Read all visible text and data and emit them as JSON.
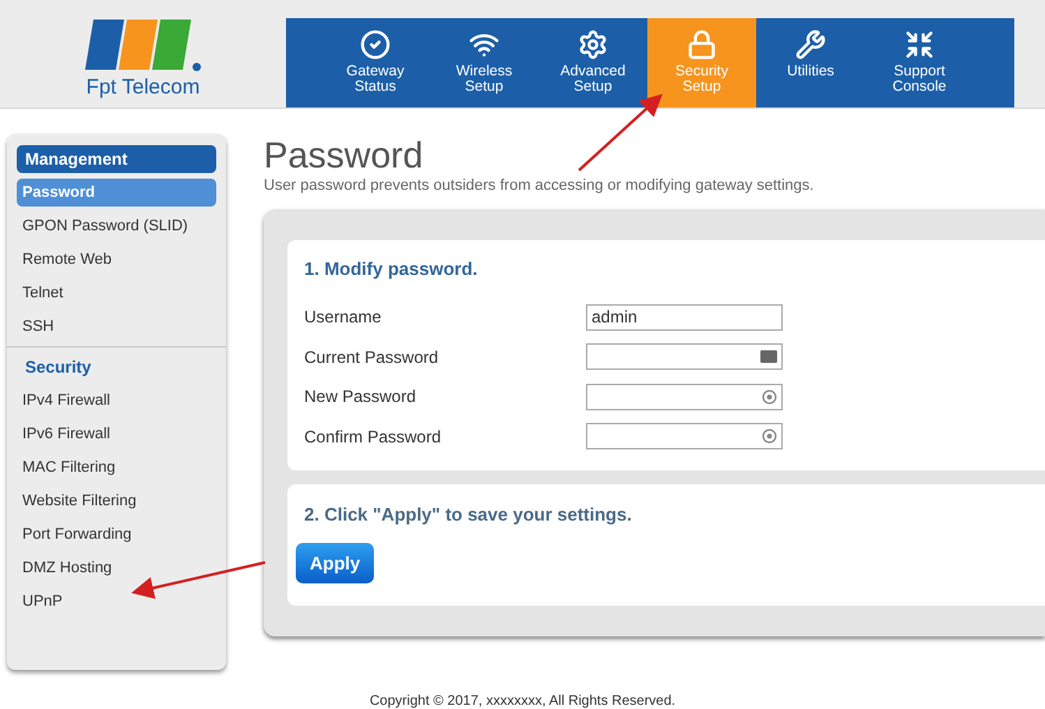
{
  "logo": {
    "brand": "Fpt Telecom"
  },
  "nav_tabs": [
    {
      "label": "Gateway Status",
      "selected": false
    },
    {
      "label": "Wireless Setup",
      "selected": false
    },
    {
      "label": "Advanced Setup",
      "selected": false
    },
    {
      "label": "Security Setup",
      "selected": true
    },
    {
      "label": "Utilities",
      "selected": false
    },
    {
      "label": "Support Console",
      "selected": false
    }
  ],
  "sidebar": {
    "groups": [
      {
        "title": "Management",
        "items": [
          {
            "label": "Password",
            "selected": true
          },
          {
            "label": "GPON Password (SLID)",
            "selected": false
          },
          {
            "label": "Remote Web",
            "selected": false
          },
          {
            "label": "Telnet",
            "selected": false
          },
          {
            "label": "SSH",
            "selected": false
          }
        ]
      },
      {
        "title": "Security",
        "items": [
          {
            "label": "IPv4 Firewall",
            "selected": false
          },
          {
            "label": "IPv6 Firewall",
            "selected": false
          },
          {
            "label": "MAC Filtering",
            "selected": false
          },
          {
            "label": "Website Filtering",
            "selected": false
          },
          {
            "label": "Port Forwarding",
            "selected": false
          },
          {
            "label": "DMZ Hosting",
            "selected": false
          },
          {
            "label": "UPnP",
            "selected": false
          }
        ]
      }
    ]
  },
  "page": {
    "title": "Password",
    "description": "User password prevents outsiders from accessing or modifying gateway settings."
  },
  "section_1": {
    "heading": "1. Modify password.",
    "fields": [
      {
        "label": "Username",
        "value": "admin",
        "kind": "text"
      },
      {
        "label": "Current Password",
        "kind": "key"
      },
      {
        "label": "New Password",
        "kind": "reveal"
      },
      {
        "label": "Confirm Password",
        "kind": "reveal"
      }
    ]
  },
  "section_2": {
    "heading": "2. Click \"Apply\" to save your settings.",
    "button": "Apply"
  },
  "footer": "Copyright © 2017, xxxxxxxx, All Rights Reserved."
}
